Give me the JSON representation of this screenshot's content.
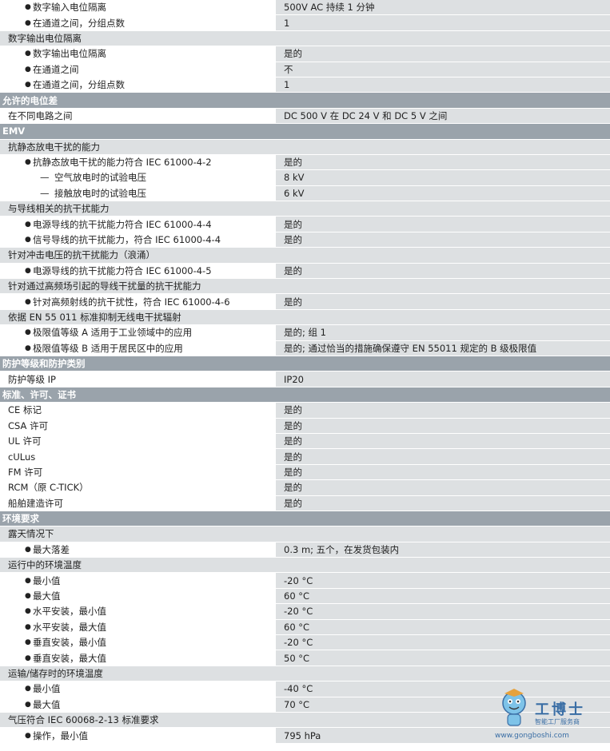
{
  "rows": [
    {
      "t": "item",
      "l": "数字输入电位隔离",
      "r": "500V AC 持续 1 分钟"
    },
    {
      "t": "item",
      "l": "在通道之间，分组点数",
      "r": "1"
    },
    {
      "t": "header",
      "l": "数字输出电位隔离"
    },
    {
      "t": "item",
      "l": "数字输出电位隔离",
      "r": "是的"
    },
    {
      "t": "item",
      "l": "在通道之间",
      "r": "不"
    },
    {
      "t": "item",
      "l": "在通道之间，分组点数",
      "r": "1"
    },
    {
      "t": "section",
      "l": "允许的电位差"
    },
    {
      "t": "plain",
      "l": "在不同电路之间",
      "r": "DC 500 V 在 DC 24 V 和 DC 5 V 之间"
    },
    {
      "t": "section",
      "l": "EMV"
    },
    {
      "t": "header",
      "l": "抗静态放电干扰的能力"
    },
    {
      "t": "item",
      "l": "抗静态放电干扰的能力符合 IEC 61000-4-2",
      "r": "是的"
    },
    {
      "t": "item2",
      "l": "空气放电时的试验电压",
      "r": "8 kV"
    },
    {
      "t": "item2",
      "l": "接触放电时的试验电压",
      "r": "6 kV"
    },
    {
      "t": "header",
      "l": "与导线相关的抗干扰能力"
    },
    {
      "t": "item",
      "l": "电源导线的抗干扰能力符合 IEC 61000-4-4",
      "r": "是的"
    },
    {
      "t": "item",
      "l": "信号导线的抗干扰能力，符合 IEC 61000-4-4",
      "r": "是的"
    },
    {
      "t": "header",
      "l": "针对冲击电压的抗干扰能力（浪涌）"
    },
    {
      "t": "item",
      "l": "电源导线的抗干扰能力符合 IEC 61000-4-5",
      "r": "是的"
    },
    {
      "t": "header",
      "l": "针对通过高频场引起的导线干扰量的抗干扰能力"
    },
    {
      "t": "item",
      "l": "针对高频射线的抗干扰性，符合 IEC 61000-4-6",
      "r": "是的"
    },
    {
      "t": "header",
      "l": "依据 EN 55 011 标准抑制无线电干扰辐射"
    },
    {
      "t": "item",
      "l": "极限值等级 A 适用于工业领域中的应用",
      "r": "是的; 组 1"
    },
    {
      "t": "item",
      "l": "极限值等级 B 适用于居民区中的应用",
      "r": "是的; 通过恰当的措施确保遵守 EN 55011 规定的 B 级极限值"
    },
    {
      "t": "section",
      "l": "防护等级和防护类别"
    },
    {
      "t": "plain",
      "l": "防护等级 IP",
      "r": "IP20"
    },
    {
      "t": "section",
      "l": "标准、许可、证书"
    },
    {
      "t": "plain",
      "l": "CE 标记",
      "r": "是的"
    },
    {
      "t": "plain",
      "l": "CSA 许可",
      "r": "是的"
    },
    {
      "t": "plain",
      "l": "UL 许可",
      "r": "是的"
    },
    {
      "t": "plain",
      "l": "cULus",
      "r": "是的"
    },
    {
      "t": "plain",
      "l": "FM 许可",
      "r": "是的"
    },
    {
      "t": "plain",
      "l": "RCM（原 C-TICK）",
      "r": "是的"
    },
    {
      "t": "plain",
      "l": "船舶建造许可",
      "r": "是的"
    },
    {
      "t": "section",
      "l": "环境要求"
    },
    {
      "t": "header",
      "l": "露天情况下"
    },
    {
      "t": "item",
      "l": "最大落差",
      "r": "0.3 m; 五个，在发货包装内"
    },
    {
      "t": "header",
      "l": "运行中的环境温度"
    },
    {
      "t": "item",
      "l": "最小值",
      "r": "-20 °C"
    },
    {
      "t": "item",
      "l": "最大值",
      "r": "60 °C"
    },
    {
      "t": "item",
      "l": "水平安装，最小值",
      "r": "-20 °C"
    },
    {
      "t": "item",
      "l": "水平安装，最大值",
      "r": "60 °C"
    },
    {
      "t": "item",
      "l": "垂直安装，最小值",
      "r": "-20 °C"
    },
    {
      "t": "item",
      "l": "垂直安装，最大值",
      "r": "50 °C"
    },
    {
      "t": "header",
      "l": "运输/储存时的环境温度"
    },
    {
      "t": "item",
      "l": "最小值",
      "r": "-40 °C"
    },
    {
      "t": "item",
      "l": "最大值",
      "r": "70 °C"
    },
    {
      "t": "header",
      "l": "气压符合 IEC 60068-2-13 标准要求"
    },
    {
      "t": "item",
      "l": "操作，最小值",
      "r": "795 hPa"
    }
  ],
  "watermark": {
    "title": "工博士",
    "subtitle": "智能工厂服务商",
    "url": "www.gongboshi.com",
    "mascot_icon": "robot-mascot-icon",
    "color": "#3a6ea5"
  }
}
